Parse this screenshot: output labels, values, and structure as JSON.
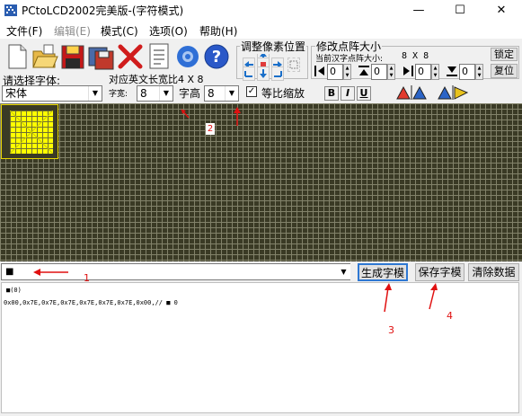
{
  "window": {
    "title": "PCtoLCD2002完美版-(字符模式)",
    "controls": {
      "minimize": "—",
      "maximize": "☐",
      "close": "✕"
    }
  },
  "menu": [
    {
      "label": "文件(F)",
      "disabled": false
    },
    {
      "label": "编辑(E)",
      "disabled": true
    },
    {
      "label": "模式(C)",
      "disabled": false
    },
    {
      "label": "选项(O)",
      "disabled": false
    },
    {
      "label": "帮助(H)",
      "disabled": false
    }
  ],
  "toolbar": {
    "icons": [
      "new-file-icon",
      "open-folder-icon",
      "save-icon",
      "save-as-icon",
      "delete-icon",
      "document-icon",
      "settings-gear-icon",
      "help-icon"
    ],
    "font_label": "请选择字体:",
    "font_value": "宋体",
    "width_label": "对应英文长宽比4 X 8",
    "char_width_label": "字宽:",
    "char_width_value": "8",
    "char_height_label": "字高",
    "char_height_value": "8",
    "proportional_label": "等比缩放",
    "proportional_checked": true,
    "pixel_position_label": "调整像素位置",
    "dot_matrix_group_label": "修改点阵大小",
    "current_size_label": "当前汉字点阵大小:",
    "current_size_value": "8 X 8",
    "lock_label": "锁定",
    "restore_label": "复位",
    "spin_values": [
      "0",
      "0",
      "0",
      "0"
    ],
    "style_buttons": [
      "B",
      "I",
      "U"
    ]
  },
  "grid": {
    "cell_color": "#3a3a25",
    "line_color": "#82826a",
    "dot_color": "#ffff00",
    "annotations": {
      "label_1": "1",
      "label_2": "2",
      "label_3": "3",
      "label_4": "4"
    }
  },
  "input": {
    "value": "■"
  },
  "actions": {
    "generate": "生成字模",
    "save": "保存字模",
    "clear": "清除数据"
  },
  "output": {
    "line1": "■(0)",
    "line2": "0x00,0x7E,0x7E,0x7E,0x7E,0x7E,0x7E,0x00,// ■ 0"
  }
}
